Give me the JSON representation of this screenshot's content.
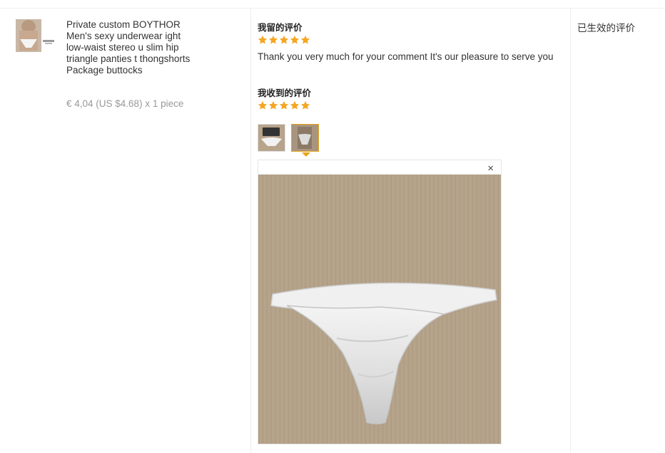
{
  "product": {
    "title": "Private custom BOYTHOR Men's sexy underwear ight low-waist stereo u slim hip triangle panties t thongshorts Package buttocks",
    "price": "€ 4,04 (US $4.68) x 1 piece"
  },
  "my_review": {
    "heading": "我留的评价",
    "rating": 5,
    "comment": "Thank you very much for your comment It's our pleasure to serve you"
  },
  "received_review": {
    "heading": "我收到的评价",
    "rating": 5,
    "photos": [
      "photo-1",
      "photo-2"
    ],
    "selected_photo": 2
  },
  "viewer": {
    "close": "×"
  },
  "status": {
    "label": "已生效的评价"
  },
  "colors": {
    "star": "#f5a623",
    "selected_border": "#e8a317",
    "divider": "#eeeeee"
  }
}
